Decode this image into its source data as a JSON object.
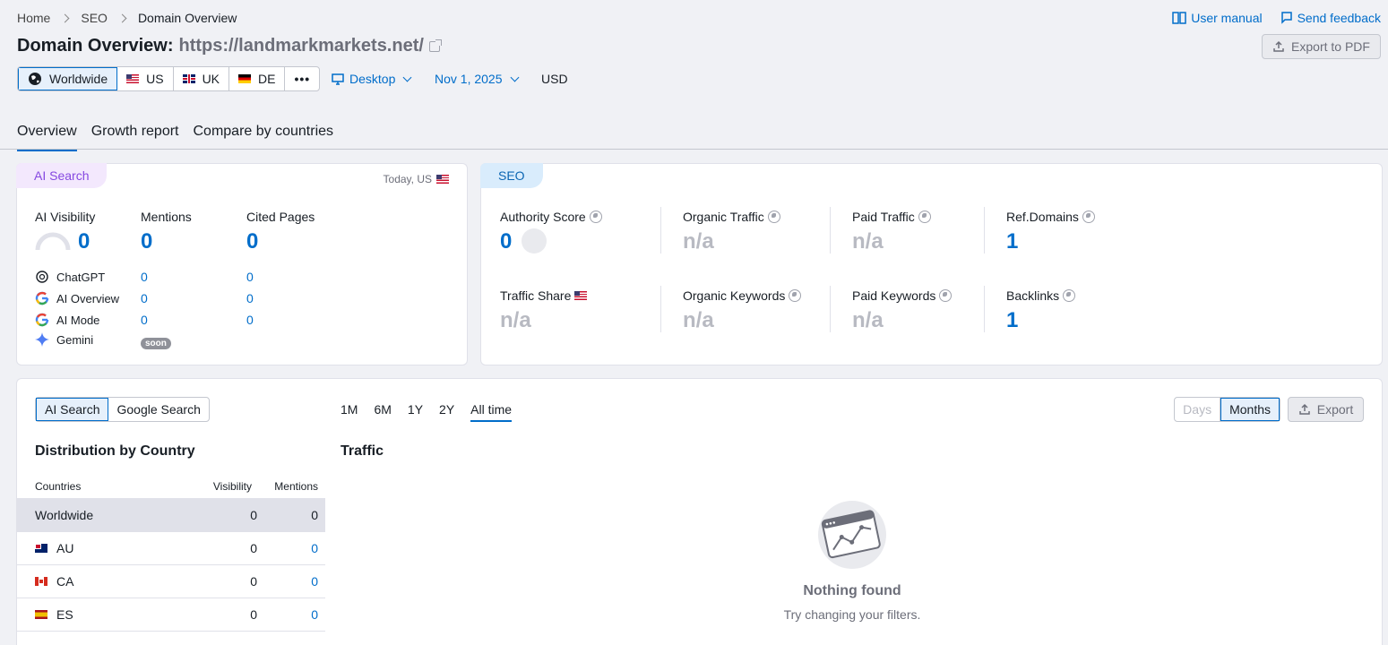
{
  "breadcrumb": {
    "home": "Home",
    "seo": "SEO",
    "current": "Domain Overview"
  },
  "header": {
    "title": "Domain Overview:",
    "url": "https://landmarkmarkets.net/"
  },
  "top_links": {
    "manual": "User manual",
    "feedback": "Send feedback",
    "export_pdf": "Export to PDF"
  },
  "databases": [
    {
      "label": "Worldwide"
    },
    {
      "label": "US"
    },
    {
      "label": "UK"
    },
    {
      "label": "DE"
    }
  ],
  "device": "Desktop",
  "date": "Nov 1, 2025",
  "currency": "USD",
  "tabs": [
    {
      "label": "Overview"
    },
    {
      "label": "Growth report"
    },
    {
      "label": "Compare by countries"
    }
  ],
  "ai_card": {
    "tag": "AI Search",
    "meta": "Today, US",
    "metrics": [
      {
        "label": "AI Visibility",
        "value": "0"
      },
      {
        "label": "Mentions",
        "value": "0"
      },
      {
        "label": "Cited Pages",
        "value": "0"
      }
    ],
    "rows": [
      {
        "label": "ChatGPT",
        "mentions": "0",
        "cited": "0"
      },
      {
        "label": "AI Overview",
        "mentions": "0",
        "cited": "0"
      },
      {
        "label": "AI Mode",
        "mentions": "0",
        "cited": "0"
      },
      {
        "label": "Gemini",
        "badge": "soon"
      }
    ]
  },
  "seo_card": {
    "tag": "SEO",
    "metrics": [
      {
        "label": "Authority Score",
        "value": "0"
      },
      {
        "label": "Organic Traffic",
        "value": "n/a"
      },
      {
        "label": "Paid Traffic",
        "value": "n/a"
      },
      {
        "label": "Ref.Domains",
        "value": "1"
      },
      {
        "label": "Traffic Share",
        "value": "n/a"
      },
      {
        "label": "Organic Keywords",
        "value": "n/a"
      },
      {
        "label": "Paid Keywords",
        "value": "n/a"
      },
      {
        "label": "Backlinks",
        "value": "1"
      }
    ]
  },
  "bottom": {
    "source_toggle": [
      "AI Search",
      "Google Search"
    ],
    "periods": [
      "1M",
      "6M",
      "1Y",
      "2Y",
      "All time"
    ],
    "granularity": [
      "Days",
      "Months"
    ],
    "export": "Export",
    "distribution_title": "Distribution by Country",
    "traffic_title": "Traffic",
    "columns": [
      "Countries",
      "Visibility",
      "Mentions"
    ],
    "rows": [
      {
        "country": "Worldwide",
        "visibility": "0",
        "mentions": "0"
      },
      {
        "country": "AU",
        "visibility": "0",
        "mentions": "0"
      },
      {
        "country": "CA",
        "visibility": "0",
        "mentions": "0"
      },
      {
        "country": "ES",
        "visibility": "0",
        "mentions": "0"
      }
    ],
    "empty_title": "Nothing found",
    "empty_sub": "Try changing your filters."
  }
}
